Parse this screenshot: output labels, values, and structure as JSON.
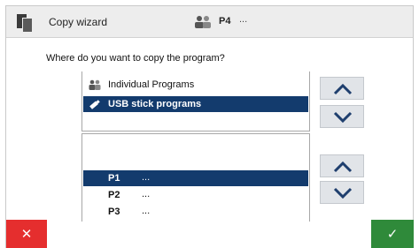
{
  "header": {
    "title": "Copy wizard",
    "program_name": "P4",
    "program_more": "...",
    "wizard_icon": "copy-icon",
    "program_icon": "program-people-icon"
  },
  "question": "Where do you want to copy the program?",
  "destinations": [
    {
      "label": "Individual Programs",
      "icon": "people-icon",
      "selected": false
    },
    {
      "label": "USB stick programs",
      "icon": "usb-stick-icon",
      "selected": true
    }
  ],
  "slots": [
    {
      "label": "P1",
      "value": "...",
      "selected": true
    },
    {
      "label": "P2",
      "value": "...",
      "selected": false
    },
    {
      "label": "P3",
      "value": "...",
      "selected": false
    }
  ],
  "buttons": {
    "cancel_glyph": "✕",
    "ok_glyph": "✓"
  },
  "colors": {
    "selection": "#133b6d",
    "cancel": "#e52e2e",
    "confirm": "#2f8a3a",
    "arrow": "#1f3f6e"
  }
}
